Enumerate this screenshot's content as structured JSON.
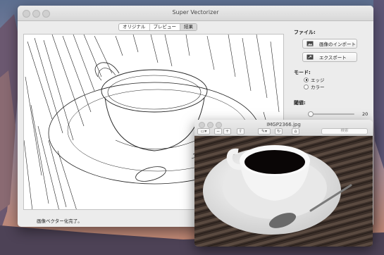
{
  "main_window": {
    "title": "Super Vectorizer",
    "tabs": [
      {
        "label": "オリジナル",
        "active": false
      },
      {
        "label": "プレビュー",
        "active": false
      },
      {
        "label": "結果",
        "active": true
      }
    ],
    "status": "画像ベクター化完了。"
  },
  "side_panel": {
    "file_label": "ファイル:",
    "import_button": "画像のインポート",
    "export_button": "エクスポート",
    "mode_label": "モード:",
    "mode_options": [
      {
        "label": "エッジ",
        "selected": true
      },
      {
        "label": "カラー",
        "selected": false
      }
    ],
    "threshold_label": "閾値:",
    "threshold_value": "20",
    "threshold_fraction": 0.06
  },
  "preview_window": {
    "title": "IMGP2366.jpg",
    "search_placeholder": "検索"
  },
  "colors": {
    "accent": "#5b8ee6",
    "window_bg": "#ececec"
  }
}
